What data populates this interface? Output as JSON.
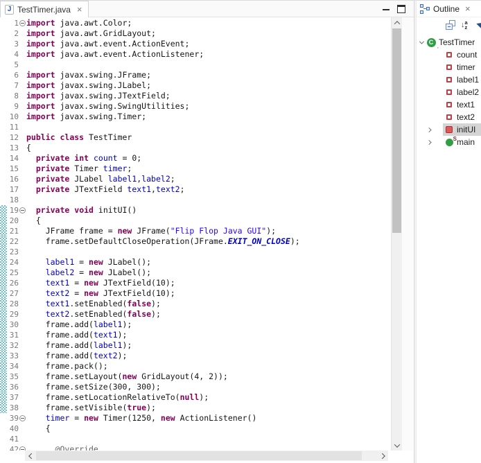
{
  "editor": {
    "tab_title": "TestTimer.java",
    "tab_close_glyph": "×",
    "code": {
      "lines": [
        {
          "n": 1,
          "f": 1,
          "r": 0,
          "s": [
            [
              "k",
              "import"
            ],
            [
              "p",
              " java.awt.Color;"
            ]
          ]
        },
        {
          "n": 2,
          "f": 0,
          "r": 0,
          "s": [
            [
              "k",
              "import"
            ],
            [
              "p",
              " java.awt.GridLayout;"
            ]
          ]
        },
        {
          "n": 3,
          "f": 0,
          "r": 0,
          "s": [
            [
              "k",
              "import"
            ],
            [
              "p",
              " java.awt.event.ActionEvent;"
            ]
          ]
        },
        {
          "n": 4,
          "f": 0,
          "r": 0,
          "s": [
            [
              "k",
              "import"
            ],
            [
              "p",
              " java.awt.event.ActionListener;"
            ]
          ]
        },
        {
          "n": 5,
          "f": 0,
          "r": 0,
          "s": []
        },
        {
          "n": 6,
          "f": 0,
          "r": 0,
          "s": [
            [
              "k",
              "import"
            ],
            [
              "p",
              " javax.swing.JFrame;"
            ]
          ]
        },
        {
          "n": 7,
          "f": 0,
          "r": 0,
          "s": [
            [
              "k",
              "import"
            ],
            [
              "p",
              " javax.swing.JLabel;"
            ]
          ]
        },
        {
          "n": 8,
          "f": 0,
          "r": 0,
          "s": [
            [
              "k",
              "import"
            ],
            [
              "p",
              " javax.swing.JTextField;"
            ]
          ]
        },
        {
          "n": 9,
          "f": 0,
          "r": 0,
          "s": [
            [
              "k",
              "import"
            ],
            [
              "p",
              " javax.swing.SwingUtilities;"
            ]
          ]
        },
        {
          "n": 10,
          "f": 0,
          "r": 0,
          "s": [
            [
              "k",
              "import"
            ],
            [
              "p",
              " javax.swing.Timer;"
            ]
          ]
        },
        {
          "n": 11,
          "f": 0,
          "r": 0,
          "s": []
        },
        {
          "n": 12,
          "f": 0,
          "r": 0,
          "s": [
            [
              "k",
              "public"
            ],
            [
              "p",
              " "
            ],
            [
              "k",
              "class"
            ],
            [
              "p",
              " TestTimer"
            ]
          ]
        },
        {
          "n": 13,
          "f": 0,
          "r": 0,
          "s": [
            [
              "p",
              "{"
            ]
          ]
        },
        {
          "n": 14,
          "f": 0,
          "r": 0,
          "s": [
            [
              "p",
              "  "
            ],
            [
              "k",
              "private"
            ],
            [
              "p",
              " "
            ],
            [
              "k",
              "int"
            ],
            [
              "p",
              " "
            ],
            [
              "f",
              "count"
            ],
            [
              "p",
              " = 0;"
            ]
          ]
        },
        {
          "n": 15,
          "f": 0,
          "r": 0,
          "s": [
            [
              "p",
              "  "
            ],
            [
              "k",
              "private"
            ],
            [
              "p",
              " Timer "
            ],
            [
              "f",
              "timer"
            ],
            [
              "p",
              ";"
            ]
          ]
        },
        {
          "n": 16,
          "f": 0,
          "r": 0,
          "s": [
            [
              "p",
              "  "
            ],
            [
              "k",
              "private"
            ],
            [
              "p",
              " JLabel "
            ],
            [
              "f",
              "label1"
            ],
            [
              "p",
              ","
            ],
            [
              "f",
              "label2"
            ],
            [
              "p",
              ";"
            ]
          ]
        },
        {
          "n": 17,
          "f": 0,
          "r": 0,
          "s": [
            [
              "p",
              "  "
            ],
            [
              "k",
              "private"
            ],
            [
              "p",
              " JTextField "
            ],
            [
              "f",
              "text1"
            ],
            [
              "p",
              ","
            ],
            [
              "f",
              "text2"
            ],
            [
              "p",
              ";"
            ]
          ]
        },
        {
          "n": 18,
          "f": 0,
          "r": 0,
          "s": []
        },
        {
          "n": 19,
          "f": 1,
          "r": 1,
          "s": [
            [
              "p",
              "  "
            ],
            [
              "k",
              "private"
            ],
            [
              "p",
              " "
            ],
            [
              "k",
              "void"
            ],
            [
              "p",
              " initUI()"
            ]
          ]
        },
        {
          "n": 20,
          "f": 0,
          "r": 1,
          "s": [
            [
              "p",
              "  {"
            ]
          ]
        },
        {
          "n": 21,
          "f": 0,
          "r": 1,
          "s": [
            [
              "p",
              "    JFrame frame = "
            ],
            [
              "k",
              "new"
            ],
            [
              "p",
              " JFrame("
            ],
            [
              "s",
              "\"Flip Flop Java GUI\""
            ],
            [
              "p",
              ");"
            ]
          ]
        },
        {
          "n": 22,
          "f": 0,
          "r": 1,
          "s": [
            [
              "p",
              "    frame.setDefaultCloseOperation(JFrame."
            ],
            [
              "x",
              "EXIT_ON_CLOSE"
            ],
            [
              "p",
              ");"
            ]
          ]
        },
        {
          "n": 23,
          "f": 0,
          "r": 1,
          "s": []
        },
        {
          "n": 24,
          "f": 0,
          "r": 1,
          "s": [
            [
              "p",
              "    "
            ],
            [
              "f",
              "label1"
            ],
            [
              "p",
              " = "
            ],
            [
              "k",
              "new"
            ],
            [
              "p",
              " JLabel();"
            ]
          ]
        },
        {
          "n": 25,
          "f": 0,
          "r": 1,
          "s": [
            [
              "p",
              "    "
            ],
            [
              "f",
              "label2"
            ],
            [
              "p",
              " = "
            ],
            [
              "k",
              "new"
            ],
            [
              "p",
              " JLabel();"
            ]
          ]
        },
        {
          "n": 26,
          "f": 0,
          "r": 1,
          "s": [
            [
              "p",
              "    "
            ],
            [
              "f",
              "text1"
            ],
            [
              "p",
              " = "
            ],
            [
              "k",
              "new"
            ],
            [
              "p",
              " JTextField(10);"
            ]
          ]
        },
        {
          "n": 27,
          "f": 0,
          "r": 1,
          "s": [
            [
              "p",
              "    "
            ],
            [
              "f",
              "text2"
            ],
            [
              "p",
              " = "
            ],
            [
              "k",
              "new"
            ],
            [
              "p",
              " JTextField(10);"
            ]
          ]
        },
        {
          "n": 28,
          "f": 0,
          "r": 1,
          "s": [
            [
              "p",
              "    "
            ],
            [
              "f",
              "text1"
            ],
            [
              "p",
              ".setEnabled("
            ],
            [
              "k",
              "false"
            ],
            [
              "p",
              ");"
            ]
          ]
        },
        {
          "n": 29,
          "f": 0,
          "r": 1,
          "s": [
            [
              "p",
              "    "
            ],
            [
              "f",
              "text2"
            ],
            [
              "p",
              ".setEnabled("
            ],
            [
              "k",
              "false"
            ],
            [
              "p",
              ");"
            ]
          ]
        },
        {
          "n": 30,
          "f": 0,
          "r": 1,
          "s": [
            [
              "p",
              "    frame.add("
            ],
            [
              "f",
              "label1"
            ],
            [
              "p",
              ");"
            ]
          ]
        },
        {
          "n": 31,
          "f": 0,
          "r": 1,
          "s": [
            [
              "p",
              "    frame.add("
            ],
            [
              "f",
              "text1"
            ],
            [
              "p",
              ");"
            ]
          ]
        },
        {
          "n": 32,
          "f": 0,
          "r": 1,
          "s": [
            [
              "p",
              "    frame.add("
            ],
            [
              "f",
              "label1"
            ],
            [
              "p",
              ");"
            ]
          ]
        },
        {
          "n": 33,
          "f": 0,
          "r": 1,
          "s": [
            [
              "p",
              "    frame.add("
            ],
            [
              "f",
              "text2"
            ],
            [
              "p",
              ");"
            ]
          ]
        },
        {
          "n": 34,
          "f": 0,
          "r": 1,
          "s": [
            [
              "p",
              "    frame.pack();"
            ]
          ]
        },
        {
          "n": 35,
          "f": 0,
          "r": 1,
          "s": [
            [
              "p",
              "    frame.setLayout("
            ],
            [
              "k",
              "new"
            ],
            [
              "p",
              " GridLayout(4, 2));"
            ]
          ]
        },
        {
          "n": 36,
          "f": 0,
          "r": 1,
          "s": [
            [
              "p",
              "    frame.setSize(300, 300);"
            ]
          ]
        },
        {
          "n": 37,
          "f": 0,
          "r": 1,
          "s": [
            [
              "p",
              "    frame.setLocationRelativeTo("
            ],
            [
              "k",
              "null"
            ],
            [
              "p",
              ");"
            ]
          ]
        },
        {
          "n": 38,
          "f": 0,
          "r": 1,
          "s": [
            [
              "p",
              "    frame.setVisible("
            ],
            [
              "k",
              "true"
            ],
            [
              "p",
              ");"
            ]
          ]
        },
        {
          "n": 39,
          "f": 1,
          "r": 0,
          "s": [
            [
              "p",
              "    "
            ],
            [
              "f",
              "timer"
            ],
            [
              "p",
              " = "
            ],
            [
              "k",
              "new"
            ],
            [
              "p",
              " Timer(1250, "
            ],
            [
              "k",
              "new"
            ],
            [
              "p",
              " ActionListener()"
            ]
          ]
        },
        {
          "n": 40,
          "f": 0,
          "r": 0,
          "s": [
            [
              "p",
              "    {"
            ]
          ]
        },
        {
          "n": 41,
          "f": 0,
          "r": 0,
          "s": []
        },
        {
          "n": 42,
          "f": 1,
          "r": 0,
          "s": [
            [
              "p",
              "      "
            ],
            [
              "a",
              "@Override"
            ]
          ]
        }
      ]
    }
  },
  "outline": {
    "title": "Outline",
    "close_glyph": "×",
    "items": [
      {
        "depth": 0,
        "arrow": "down",
        "icon": "class",
        "label": "TestTimer",
        "selected": false
      },
      {
        "depth": 1,
        "arrow": "",
        "icon": "field-private",
        "label": "count",
        "selected": false
      },
      {
        "depth": 1,
        "arrow": "",
        "icon": "field-private",
        "label": "timer",
        "selected": false
      },
      {
        "depth": 1,
        "arrow": "",
        "icon": "field-private",
        "label": "label1",
        "selected": false
      },
      {
        "depth": 1,
        "arrow": "",
        "icon": "field-private",
        "label": "label2",
        "selected": false
      },
      {
        "depth": 1,
        "arrow": "",
        "icon": "field-private",
        "label": "text1",
        "selected": false
      },
      {
        "depth": 1,
        "arrow": "",
        "icon": "field-private",
        "label": "text2",
        "selected": false
      },
      {
        "depth": 1,
        "arrow": "right",
        "icon": "method-private",
        "label": "initUI",
        "selected": true
      },
      {
        "depth": 1,
        "arrow": "right",
        "icon": "method-static",
        "label": "main",
        "decorator": "S",
        "selected": false
      }
    ]
  },
  "colors": {
    "keyword": "#7F0055",
    "field": "#0000C0",
    "string": "#2A00FF",
    "annotation": "#646464",
    "line_number": "#787878",
    "range_hatch": "#72bfcb",
    "selection_bg": "#d4d4d4",
    "class_green": "#2f9e44"
  }
}
